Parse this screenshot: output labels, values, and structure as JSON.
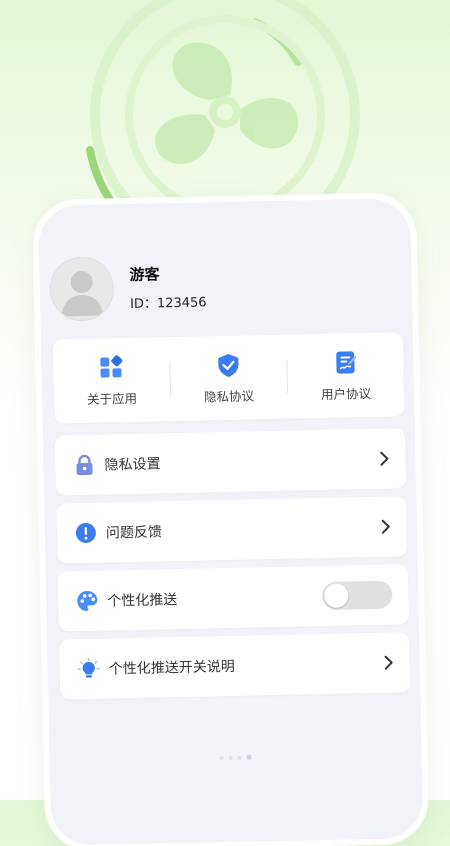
{
  "profile": {
    "name": "游客",
    "id_text": "ID：123456"
  },
  "quick_links": [
    {
      "label": "关于应用",
      "icon": "apps-icon"
    },
    {
      "label": "隐私协议",
      "icon": "shield-check-icon"
    },
    {
      "label": "用户协议",
      "icon": "document-sign-icon"
    }
  ],
  "menu": [
    {
      "label": "隐私设置",
      "icon": "lock-icon"
    },
    {
      "label": "问题反馈",
      "icon": "exclamation-icon"
    },
    {
      "label": "个性化推送",
      "icon": "palette-icon",
      "toggle_on": false
    },
    {
      "label": "个性化推送开关说明",
      "icon": "lightbulb-icon"
    }
  ],
  "colors": {
    "accent": "#3b7cf0",
    "lock": "#7a8de3",
    "palette": "#4a8df5",
    "toggle_off": "#e0e0e3"
  },
  "page_indicator": {
    "total": 4,
    "active": 4
  }
}
